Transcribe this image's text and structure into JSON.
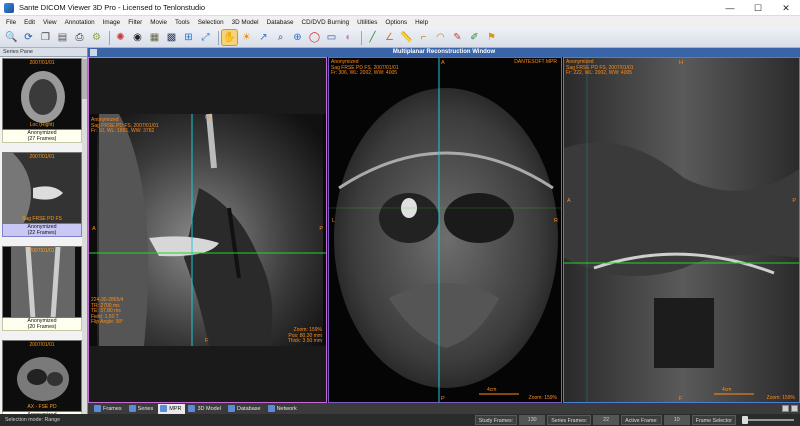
{
  "window": {
    "title": "Sante DICOM Viewer 3D Pro - Licensed to Tenlonstudio",
    "controls": {
      "minimize": "—",
      "maximize": "☐",
      "close": "✕"
    }
  },
  "menu": [
    "File",
    "Edit",
    "View",
    "Annotation",
    "Image",
    "Filter",
    "Movie",
    "Tools",
    "Selection",
    "3D Model",
    "Database",
    "CD/DVD Burning",
    "Utilities",
    "Options",
    "Help"
  ],
  "toolbar_icons": [
    "zoom-in-icon",
    "rotate-icon",
    "copy-icon",
    "document-icon",
    "print-icon",
    "settings-icon",
    "brain-icon",
    "eye-icon",
    "cine-icon",
    "grid-icon",
    "layout-icon",
    "fit-icon",
    "hand-icon",
    "brightness-icon",
    "arrow-icon",
    "magnify-icon",
    "zoom-icon",
    "roi-icon",
    "rectangle-icon",
    "color-icon",
    "line-icon",
    "angle-icon",
    "ruler-icon",
    "cobb-icon",
    "protractor-icon",
    "probe-icon",
    "annotation-icon",
    "stamp-icon"
  ],
  "series_pane": {
    "header": "Series Pane",
    "items": [
      {
        "overlay_top": "2007/01/01",
        "overlay_bottom": "Loc (Right)",
        "name": "Anonymized",
        "frames": "(27 Frames)",
        "active": false
      },
      {
        "overlay_top": "2007/01/01",
        "overlay_bottom": "Sag FRSE PD FS",
        "name": "Anonymized",
        "frames": "(22 Frames)",
        "active": true
      },
      {
        "overlay_top": "2007/01/01",
        "overlay_bottom": "",
        "name": "Anonymized",
        "frames": "(20 Frames)",
        "active": false
      },
      {
        "overlay_top": "2007/01/01",
        "overlay_bottom": "AX - FSE PD",
        "name": "Anonymized",
        "frames": "(24 Frames)",
        "active": false
      }
    ]
  },
  "mpr": {
    "title": "Multiplanar Reconstruction Window",
    "viewports": [
      {
        "overlay_lines": [
          "Anonymized",
          "Sag FRSE PD FS, 2007/01/01",
          "Fr: 10, WL: 1891, WW: 3782"
        ],
        "overlay_bottom_lines": [
          "224-30-2865/4",
          "TR: 2700 ms",
          "TE: 37.80 ms",
          "Field: 1.50 T",
          "Flip Angle: 90°"
        ],
        "overlay_bottom_right_lines": [
          "Zoom: 159%",
          "Pos: 80.30 mm",
          "Thick: 3.50 mm"
        ],
        "markers": {
          "top": "H",
          "left": "A",
          "right": "P",
          "bottom": "F"
        }
      },
      {
        "overlay_lines": [
          "Anonymized",
          "Sag FRSE PD FS, 2007/01/01",
          "Fr: 306, WL: 2002, WW: 4005"
        ],
        "overlay_right": "DANTESOFT MPR",
        "scale_label": "4cm",
        "zoom": "Zoom: 159%",
        "markers": {
          "top": "A",
          "left": "L",
          "right": "R",
          "bottom": "P"
        }
      },
      {
        "overlay_lines": [
          "Anonymized",
          "Sag FRSE PD FS, 2007/01/01",
          "Fr: 222, WL: 2002, WW: 4005"
        ],
        "scale_label": "4cm",
        "zoom": "Zoom: 159%",
        "markers": {
          "top": "H",
          "left": "A",
          "right": "P",
          "bottom": "F"
        }
      }
    ]
  },
  "tabs": [
    {
      "label": "Frames",
      "active": false
    },
    {
      "label": "Series",
      "active": false
    },
    {
      "label": "MPR",
      "active": true
    },
    {
      "label": "3D Model",
      "active": false
    },
    {
      "label": "Database",
      "active": false
    },
    {
      "label": "Network",
      "active": false
    }
  ],
  "status": {
    "selection_mode": "Selection mode: Range",
    "fields": [
      {
        "label": "Study Frames:",
        "value": "130"
      },
      {
        "label": "Series Frames:",
        "value": "22"
      },
      {
        "label": "Active Frame:",
        "value": "10"
      }
    ],
    "frame_selector": "Frame Selector"
  },
  "colors": {
    "overlay_text": "#ff8c1a",
    "crosshair_cyan": "#1fc8d8",
    "crosshair_green": "#2ad12a",
    "mpr_header": "#3a64a8"
  }
}
